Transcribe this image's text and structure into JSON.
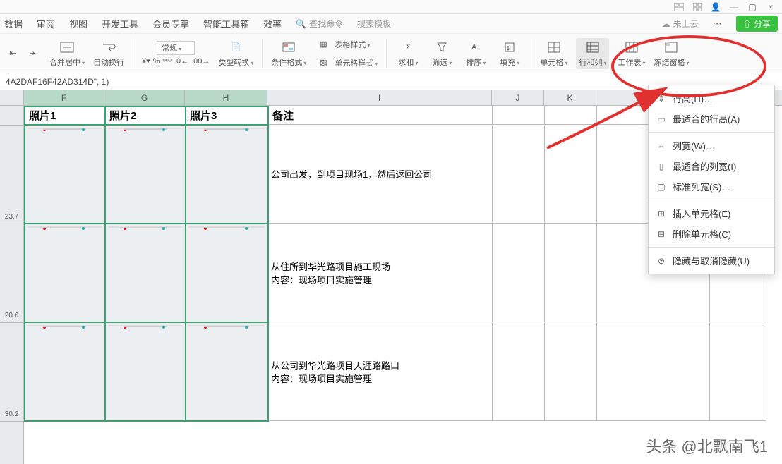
{
  "titlebar": {
    "minimize": "—",
    "close": "×"
  },
  "menubar": {
    "items": [
      "数据",
      "审阅",
      "视图",
      "开发工具",
      "会员专享",
      "智能工具箱",
      "效率"
    ],
    "search_label": "查找命令",
    "search_placeholder": "搜索模板",
    "cloud_label": "未上云",
    "share_label": "分享"
  },
  "toolbar": {
    "merge": "合并居中",
    "autowrap": "自动换行",
    "general": "常规",
    "percent": "%",
    "typeconv": "类型转换",
    "condfmt": "条件格式",
    "tablestyle": "表格样式",
    "cellstyle": "单元格样式",
    "sum": "求和",
    "filter": "筛选",
    "sort": "排序",
    "fill": "填充",
    "cellgroup": "单元格",
    "rowcol": "行和列",
    "worksheet": "工作表",
    "freeze": "冻结窗格"
  },
  "formula": "4A2DAF16F42AD314D\", 1)",
  "columns": {
    "E": "",
    "F": "照片1",
    "G": "照片2",
    "H": "照片3",
    "I": "备注",
    "J": "",
    "K": "",
    "L": "",
    "M": ""
  },
  "rows": [
    {
      "label": "23.7",
      "note": "公司出发，到项目现场1，然后返回公司"
    },
    {
      "label": "20.6",
      "note": "从住所到华光路项目施工现场\n内容：现场项目实施管理"
    },
    {
      "label": "30.2",
      "note": "从公司到华光路项目天涯路路口\n内容：现场项目实施管理"
    }
  ],
  "menu": {
    "row_height": "行高(H)…",
    "autofit_row": "最适合的行高(A)",
    "col_width": "列宽(W)…",
    "autofit_col": "最适合的列宽(I)",
    "std_width": "标准列宽(S)…",
    "insert_cell": "插入单元格(E)",
    "delete_cell": "删除单元格(C)",
    "hide": "隐藏与取消隐藏(U)"
  },
  "watermark": "头条 @北飘南飞1"
}
